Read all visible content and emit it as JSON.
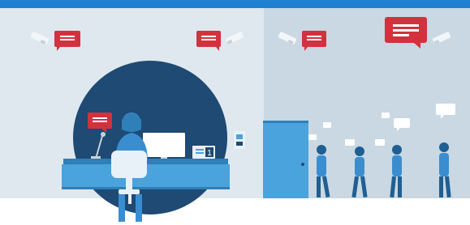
{
  "scene": {
    "colors": {
      "top_bar": "#1f7fd1",
      "left_wall": "#dfe8ef",
      "right_wall": "#c9d8e2",
      "floor": "#ffffff",
      "circle": "#1e4a73",
      "desk": "#4aa3dc",
      "desk_dark": "#2f7fb8",
      "chair": "#e8f1f8",
      "speech_red": "#d3313e",
      "speech_white": "#ffffff",
      "camera_white": "#f3f6f9",
      "camera_gray": "#c8d2da",
      "door": "#4aa3dc",
      "people": "#3a8ed0",
      "people_dark": "#1f5f93"
    },
    "icons": [
      "security-camera-icon",
      "speech-bubble-icon",
      "monitor-icon",
      "microphone-icon",
      "person-icon",
      "door-icon",
      "queue-number-display-icon",
      "card-reader-icon"
    ],
    "queue_display_number": "1",
    "queue_size": 5
  }
}
